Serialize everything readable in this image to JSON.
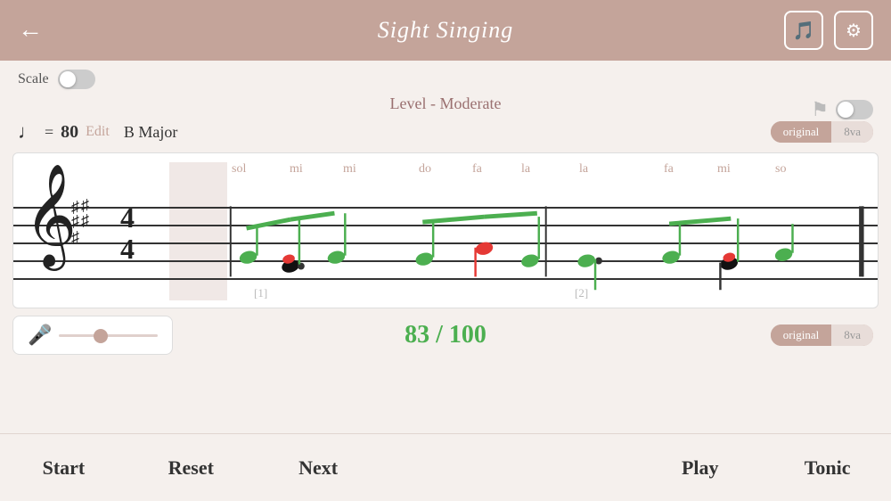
{
  "header": {
    "title": "Sight Singing",
    "back_label": "←",
    "music_icon": "♪",
    "gear_icon": "⚙"
  },
  "controls": {
    "scale_label": "Scale",
    "level_label": "Level - Moderate",
    "tempo": 80,
    "tempo_edit": "Edit",
    "key": "B Major",
    "original_label": "original",
    "octave_label": "8va"
  },
  "solfege": {
    "notes": [
      "sol",
      "mi",
      "mi",
      "",
      "do",
      "fa",
      "la",
      "",
      "la",
      "",
      "fa",
      "mi",
      "so"
    ]
  },
  "score": {
    "display": "83 / 100"
  },
  "bottom_nav": {
    "start": "Start",
    "reset": "Reset",
    "next": "Next",
    "play": "Play",
    "tonic": "Tonic"
  },
  "measure_labels": [
    "[1]",
    "[2]"
  ],
  "colors": {
    "header_bg": "#c4a49a",
    "accent": "#c4a49a",
    "score_green": "#4caf50",
    "note_green": "#4caf50",
    "note_red": "#e53935",
    "note_black": "#222222"
  }
}
